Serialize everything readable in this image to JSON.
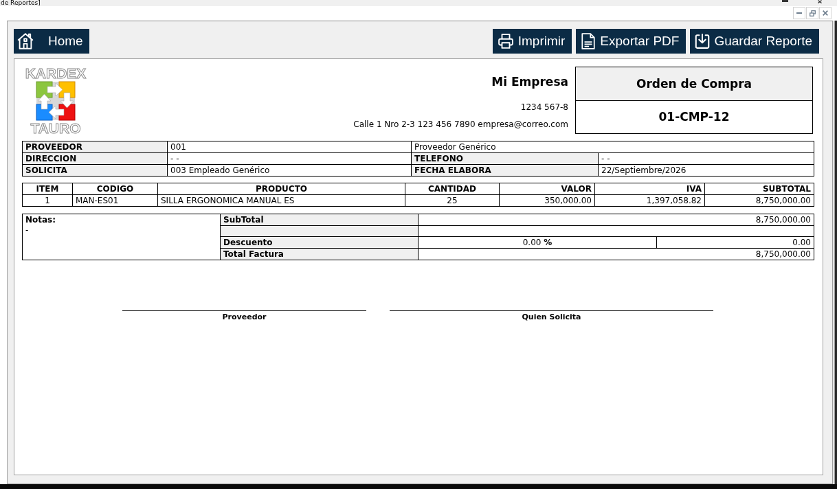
{
  "window": {
    "title": "de Reportes]"
  },
  "toolbar": {
    "home": {
      "label": "Home"
    },
    "actions": [
      {
        "kind": "print",
        "label": "Imprimir"
      },
      {
        "kind": "pdf",
        "label": "Exportar PDF"
      },
      {
        "kind": "save",
        "label": "Guardar Reporte"
      }
    ]
  },
  "report": {
    "logo": {
      "top_text": "KARDEX",
      "bottom_text": "TAURO"
    },
    "company": {
      "name": "Mi Empresa",
      "tax_id": "1234 567-8",
      "contact": "Calle 1 Nro 2-3 123 456 7890 empresa@correo.com"
    },
    "document": {
      "title": "Orden de Compra",
      "number": "01-CMP-12"
    },
    "info": [
      {
        "cells": [
          {
            "kind": "label",
            "text": "PROVEEDOR"
          },
          {
            "kind": "value",
            "text": "001"
          },
          {
            "kind": "wide",
            "text": "Proveedor Genérico"
          }
        ]
      },
      {
        "cells": [
          {
            "kind": "label",
            "text": "DIRECCION"
          },
          {
            "kind": "value",
            "text": "- -"
          },
          {
            "kind": "label",
            "text": "TELEFONO"
          },
          {
            "kind": "value",
            "text": "- -"
          }
        ]
      },
      {
        "cells": [
          {
            "kind": "label",
            "text": "SOLICITA"
          },
          {
            "kind": "value",
            "text": "003 Empleado Genérico"
          },
          {
            "kind": "label",
            "text": "FECHA ELABORA"
          },
          {
            "kind": "value",
            "text": "22/Septiembre/2026"
          }
        ]
      }
    ],
    "items": {
      "columns": [
        {
          "label": "ITEM",
          "kind": "index"
        },
        {
          "label": "CODIGO",
          "kind": "text"
        },
        {
          "label": "PRODUCTO",
          "kind": "text"
        },
        {
          "label": "CANTIDAD",
          "kind": "quantity"
        },
        {
          "label": "VALOR",
          "kind": "amount"
        },
        {
          "label": "IVA",
          "kind": "amount"
        },
        {
          "label": "SUBTOTAL",
          "kind": "amount"
        }
      ],
      "rows": [
        [
          "1",
          "MAN-ES01",
          "SILLA ERGONOMICA MANUAL ES",
          "25",
          "350,000.00",
          "1,397,058.82",
          "8,750,000.00"
        ]
      ]
    },
    "notes": {
      "label": "Notas:",
      "text": "-"
    },
    "totals": [
      {
        "kind": "amount",
        "label": "SubTotal",
        "value": "8,750,000.00"
      },
      {
        "kind": "blank"
      },
      {
        "kind": "discount",
        "label": "Descuento",
        "rate": "0.00 **%**",
        "value": "0.00"
      },
      {
        "kind": "amount",
        "label": "Total Factura",
        "value": "8,750,000.00"
      }
    ],
    "signatures": [
      {
        "label": "Proveedor"
      },
      {
        "label": "Quien Solicita"
      }
    ]
  }
}
